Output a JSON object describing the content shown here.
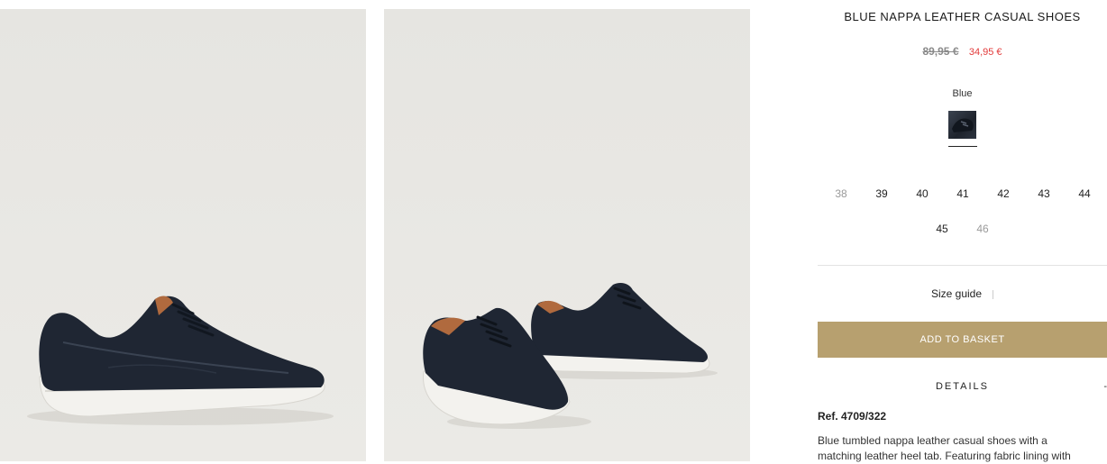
{
  "product": {
    "title": "BLUE NAPPA LEATHER CASUAL SHOES",
    "old_price": "89,95 €",
    "new_price": "34,95 €",
    "color_name": "Blue"
  },
  "sizes_row1": [
    "38",
    "39",
    "40",
    "41",
    "42",
    "43",
    "44"
  ],
  "sizes_row2": [
    "45",
    "46"
  ],
  "sizes_unavailable": [
    "38",
    "46"
  ],
  "size_guide_label": "Size guide",
  "add_to_basket_label": "ADD TO BASKET",
  "details": {
    "label": "DETAILS",
    "toggle": "-",
    "ref": "Ref. 4709/322",
    "description": "Blue tumbled nappa leather casual shoes with a matching leather heel tab. Featuring fabric lining with"
  },
  "colors": {
    "accent_button": "#b7a06f",
    "sale_price": "#e23a3a",
    "photo_background": "#e8e7e3",
    "shoe_leather": "#1f2633",
    "sole": "#f2f1ec"
  }
}
